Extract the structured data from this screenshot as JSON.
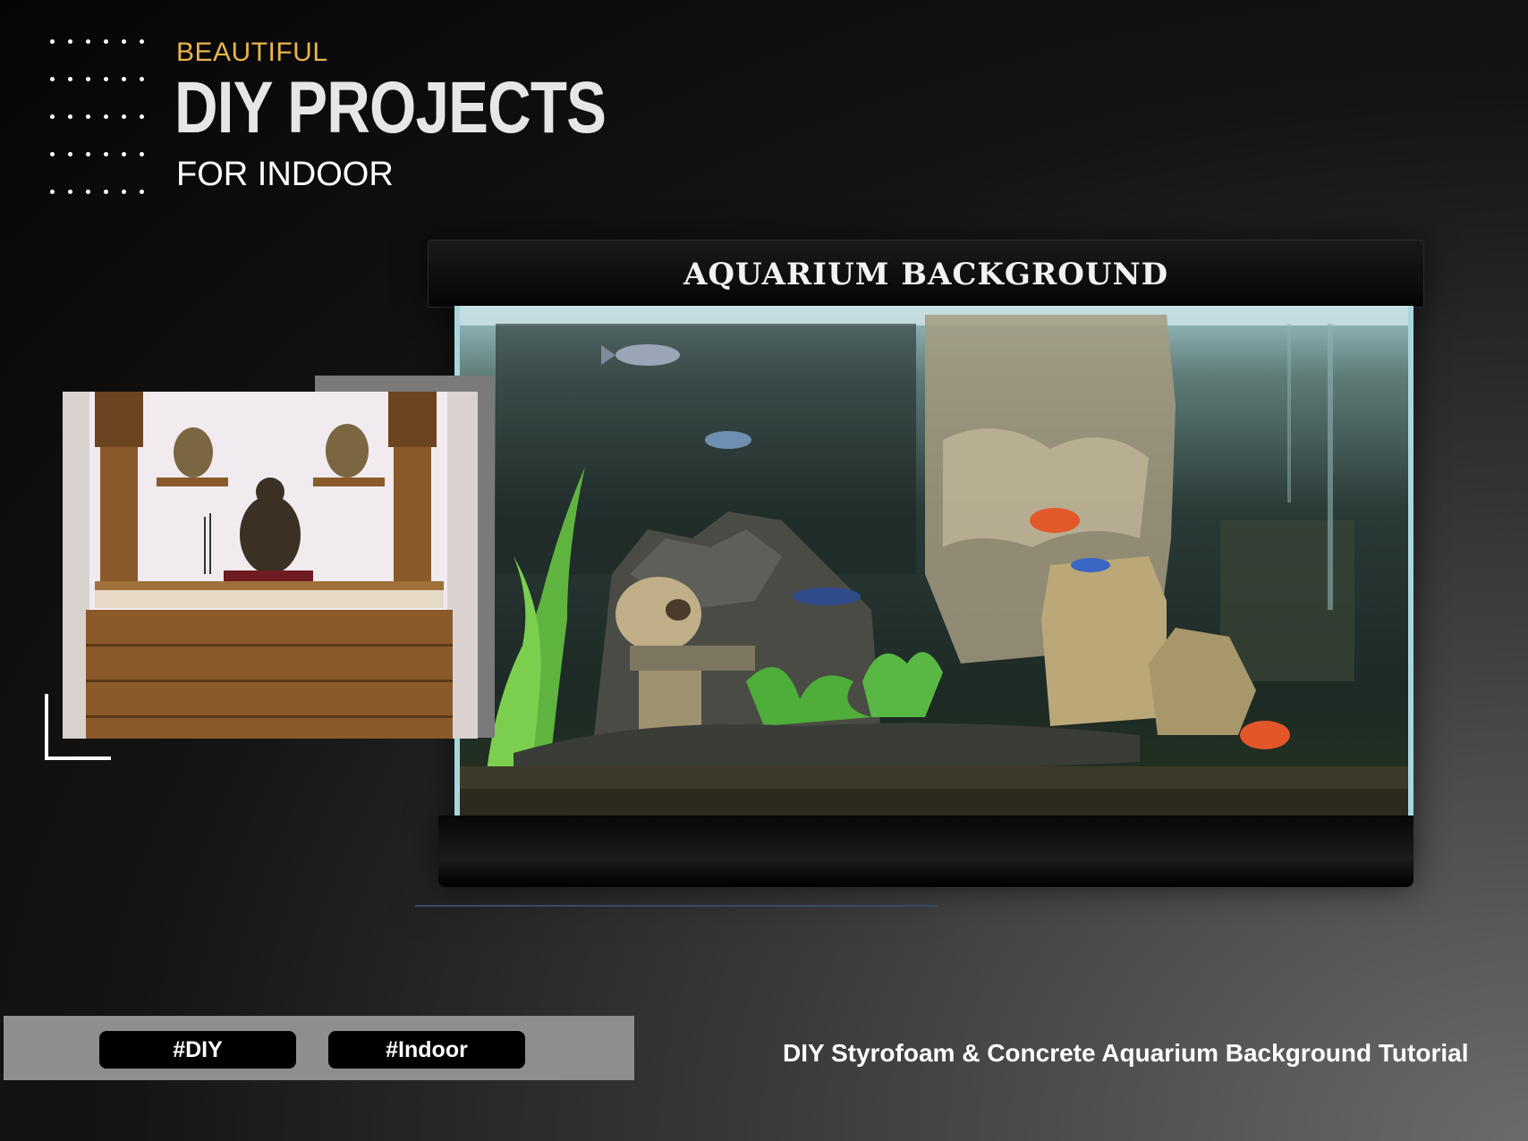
{
  "header": {
    "kicker": "BEAUTIFUL",
    "title": "DIY PROJECTS",
    "subtitle": "FOR INDOOR"
  },
  "aquarium": {
    "title": "AQUARIUM BACKGROUND"
  },
  "tags": [
    "#DIY",
    "#Indoor"
  ],
  "caption": "DIY Styrofoam & Concrete Aquarium Background Tutorial",
  "colors": {
    "accent": "#e8b54a",
    "tag_bg": "#000000",
    "tag_bar": "#8e8e8e"
  }
}
